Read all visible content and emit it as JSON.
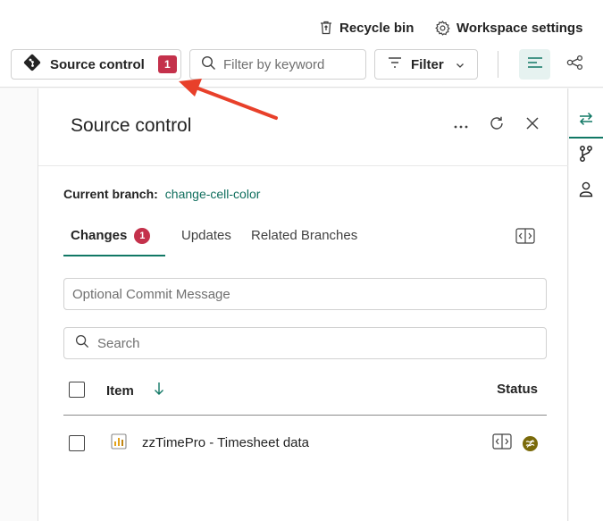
{
  "topbar": {
    "recycle_bin": "Recycle bin",
    "workspace_settings": "Workspace settings",
    "source_control_label": "Source control",
    "source_control_count": "1",
    "filter_placeholder": "Filter by keyword",
    "filter_label": "Filter"
  },
  "panel": {
    "title": "Source control",
    "current_branch_label": "Current branch:",
    "current_branch": "change-cell-color",
    "tabs": [
      {
        "label": "Changes",
        "count": "1",
        "active": true
      },
      {
        "label": "Updates"
      },
      {
        "label": "Related Branches"
      }
    ],
    "commit_placeholder": "Optional Commit Message",
    "search_placeholder": "Search",
    "table": {
      "col_item": "Item",
      "col_status": "Status",
      "rows": [
        {
          "name": "zzTimePro - Timesheet data",
          "status": "conflict"
        }
      ]
    }
  },
  "colors": {
    "accent": "#117865",
    "badge": "#c4314b",
    "annotation_arrow": "#e8402a"
  },
  "icons": [
    "git-icon",
    "recycle-bin-icon",
    "gear-icon",
    "search-icon",
    "filter-icon",
    "chevron-down-icon",
    "list-view-icon",
    "lineage-icon",
    "more-icon",
    "refresh-icon",
    "close-icon",
    "compare-icon",
    "sort-down-icon",
    "report-icon",
    "conflict-status-icon",
    "changes-icon",
    "branch-icon",
    "user-icon"
  ]
}
